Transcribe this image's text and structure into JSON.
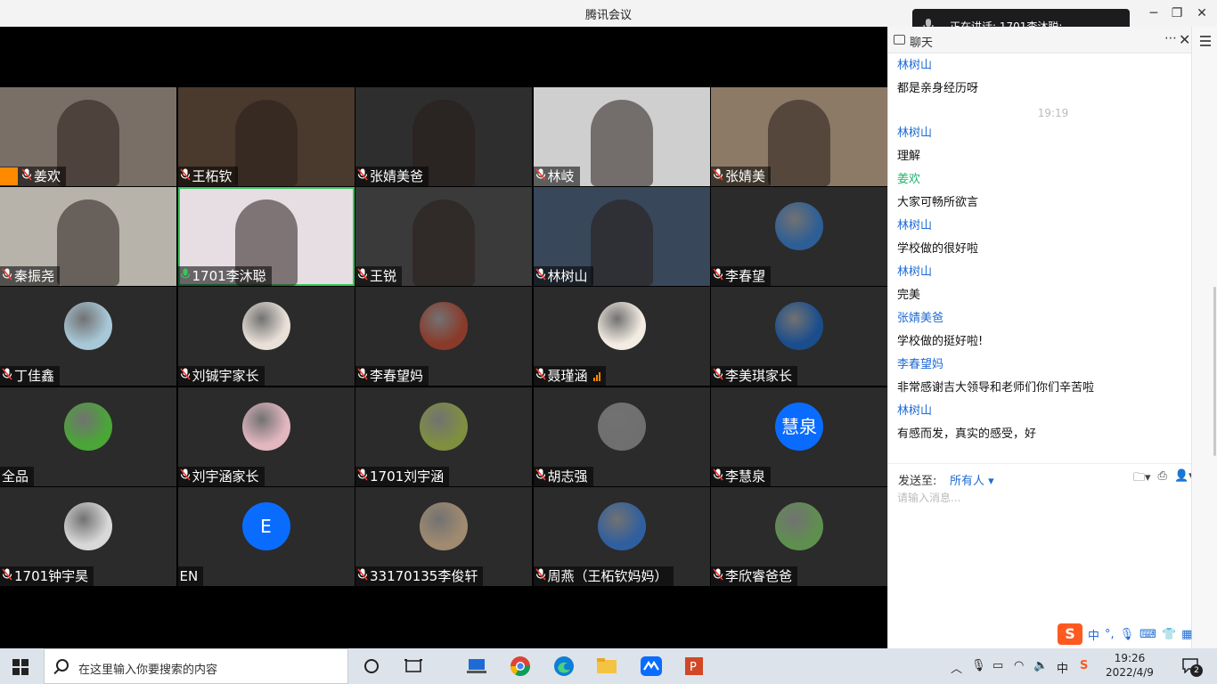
{
  "window": {
    "title": "腾讯会议"
  },
  "speaking": {
    "text": "正在讲话: 1701李沐聪;"
  },
  "participants": [
    {
      "name": "姜欢",
      "type": "video",
      "bg": "#7a6f66",
      "host": true
    },
    {
      "name": "王柘钦",
      "type": "video",
      "bg": "#4a3a2e"
    },
    {
      "name": "张婧美爸",
      "type": "video",
      "bg": "#2e2e2e"
    },
    {
      "name": "林岐",
      "type": "video",
      "bg": "#cfcfcf"
    },
    {
      "name": "张婧美",
      "type": "video",
      "bg": "#8c7a66"
    },
    {
      "name": "秦振尧",
      "type": "video",
      "bg": "#b7b2aa"
    },
    {
      "name": "1701李沐聪",
      "type": "video",
      "bg": "#e7dee4",
      "active": true
    },
    {
      "name": "王锐",
      "type": "video",
      "bg": "#3a3a3a"
    },
    {
      "name": "林树山",
      "type": "video",
      "bg": "#38485a"
    },
    {
      "name": "李春望",
      "type": "avatar",
      "avatar_color": "#2d5e96"
    },
    {
      "name": "丁佳鑫",
      "type": "avatar",
      "avatar_color": "#a8c8d8"
    },
    {
      "name": "刘铖宇家长",
      "type": "avatar",
      "avatar_color": "#e9e0d8"
    },
    {
      "name": "李春望妈",
      "type": "avatar",
      "avatar_color": "#8a3a2a"
    },
    {
      "name": "聂瑾涵",
      "type": "avatar",
      "avatar_color": "#f3ece2",
      "signal": true
    },
    {
      "name": "李美琪家长",
      "type": "avatar",
      "avatar_color": "#1a4d8c"
    },
    {
      "name": "全品",
      "type": "avatar",
      "avatar_color": "#4aa637",
      "no_mic": true
    },
    {
      "name": "刘宇涵家长",
      "type": "avatar",
      "avatar_color": "#e2b7c0"
    },
    {
      "name": "1701刘宇涵",
      "type": "avatar",
      "avatar_color": "#7f8f40"
    },
    {
      "name": "胡志强",
      "type": "avatar",
      "avatar_color": "#6f6f6f"
    },
    {
      "name": "李慧泉",
      "type": "letter",
      "letter": "慧泉"
    },
    {
      "name": "1701钟宇昊",
      "type": "avatar",
      "avatar_color": "#d8d8d8"
    },
    {
      "name": "EN",
      "type": "letter",
      "letter": "E",
      "no_mic": true
    },
    {
      "name": "33170135李俊轩",
      "type": "avatar",
      "avatar_color": "#a08a70"
    },
    {
      "name": "周燕（王柘钦妈妈）",
      "type": "avatar",
      "avatar_color": "#2f5f9f"
    },
    {
      "name": "李欣睿爸爸",
      "type": "avatar",
      "avatar_color": "#5f8f4f"
    }
  ],
  "chat": {
    "header": "聊天",
    "messages": [
      {
        "sender": "林树山",
        "text": "都是亲身经历呀"
      },
      {
        "time": "19:19"
      },
      {
        "sender": "林树山",
        "text": "理解"
      },
      {
        "sender": "姜欢",
        "text": "大家可畅所欲言",
        "green": true
      },
      {
        "sender": "林树山",
        "text": "学校做的很好啦"
      },
      {
        "sender": "林树山",
        "text": "完美"
      },
      {
        "sender": "张婧美爸",
        "text": "学校做的挺好啦!"
      },
      {
        "sender": "李春望妈",
        "text": "非常感谢吉大领导和老师们你们辛苦啦"
      },
      {
        "sender": "林树山",
        "text": "有感而发，真实的感受，好"
      }
    ],
    "send_label": "发送至:",
    "send_to": "所有人 ▾",
    "input_placeholder": "请输入消息..."
  },
  "ime": {
    "logo": "S",
    "lang": "中"
  },
  "taskbar": {
    "search_placeholder": "在这里输入你要搜索的内容",
    "tray_lang": "中",
    "time": "19:26",
    "date": "2022/4/9",
    "notification_count": "2"
  }
}
